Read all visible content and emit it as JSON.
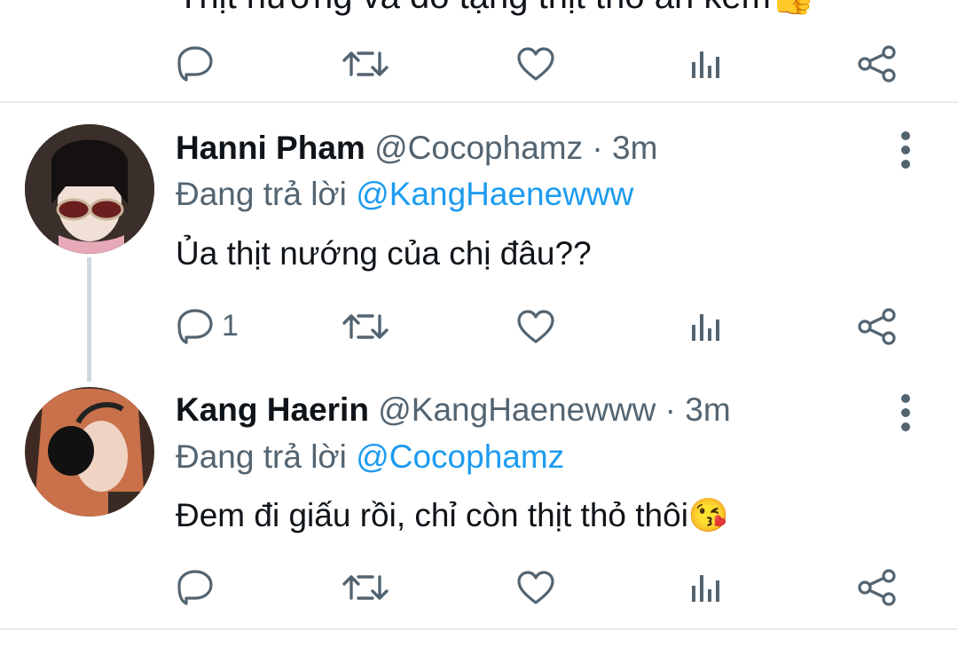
{
  "top_tweet": {
    "text_clipped": "Thịt nướng và đó tặng thịt thỏ ăn kèm",
    "emoji": "👍"
  },
  "tweets": [
    {
      "name": "Hanni Pham",
      "handle": "@Cocophamz",
      "time_sep": " · ",
      "time": "3m",
      "reply_prefix": "Đang trả lời ",
      "reply_to": "@KangHaenewww",
      "body": "Ủa thịt nướng của chị đâu??",
      "reply_count": "1"
    },
    {
      "name": "Kang Haerin",
      "handle": "@KangHaenewww",
      "time_sep": " · ",
      "time": "3m",
      "reply_prefix": "Đang trả lời ",
      "reply_to": "@Cocophamz",
      "body": "Đem đi giấu rồi, chỉ còn thịt thỏ thôi",
      "emoji": "😘",
      "reply_count": ""
    }
  ],
  "icons": [
    "reply-icon",
    "retweet-icon",
    "like-icon",
    "analytics-icon",
    "share-icon",
    "more-icon"
  ],
  "colors": {
    "text": "#0f1419",
    "secondary": "#536471",
    "link": "#1d9bf0",
    "divider": "#e6ecf0"
  }
}
